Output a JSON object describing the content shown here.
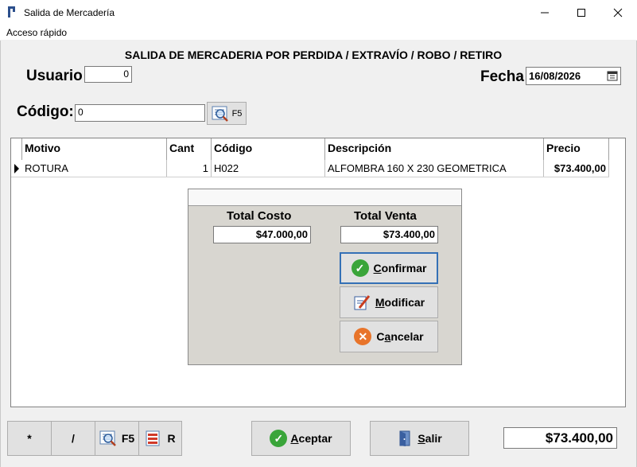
{
  "window": {
    "title": "Salida de Mercadería"
  },
  "menu": {
    "item": "Acceso rápido"
  },
  "heading": "SALIDA DE MERCADERIA POR PERDIDA / EXTRAVÍO / ROBO / RETIRO",
  "usuario": {
    "label": "Usuario",
    "value": "0"
  },
  "fecha": {
    "label": "Fecha",
    "value": "16/08/2026"
  },
  "codigo": {
    "label": "Código:",
    "value": "0",
    "button_label": "F5"
  },
  "grid": {
    "columns": [
      "Motivo",
      "Cant",
      "Código",
      "Descripción",
      "Precio"
    ],
    "rows": [
      {
        "motivo": "ROTURA",
        "cant": "1",
        "codigo": "H022",
        "descripcion": "ALFOMBRA 160 X 230 GEOMETRICA",
        "precio": "$73.400,00"
      }
    ]
  },
  "dialog": {
    "total_costo_label": "Total Costo",
    "total_costo": "$47.000,00",
    "total_venta_label": "Total Venta",
    "total_venta": "$73.400,00",
    "confirmar_label": "Confirmar",
    "confirmar_u": "C",
    "confirmar_rest": "onfirmar",
    "modificar_u": "M",
    "modificar_rest": "odificar",
    "cancelar_pre": "C",
    "cancelar_u": "a",
    "cancelar_rest": "ncelar"
  },
  "bottom": {
    "star": "*",
    "slash": "/",
    "f5": "F5",
    "r": "R",
    "aceptar_u": "A",
    "aceptar_rest": "ceptar",
    "salir_u": "S",
    "salir_rest": "alir",
    "total": "$73.400,00"
  },
  "colors": {
    "accent_focus": "#3470b6",
    "confirm_green": "#3aa53a",
    "cancel_orange": "#e8742a"
  }
}
